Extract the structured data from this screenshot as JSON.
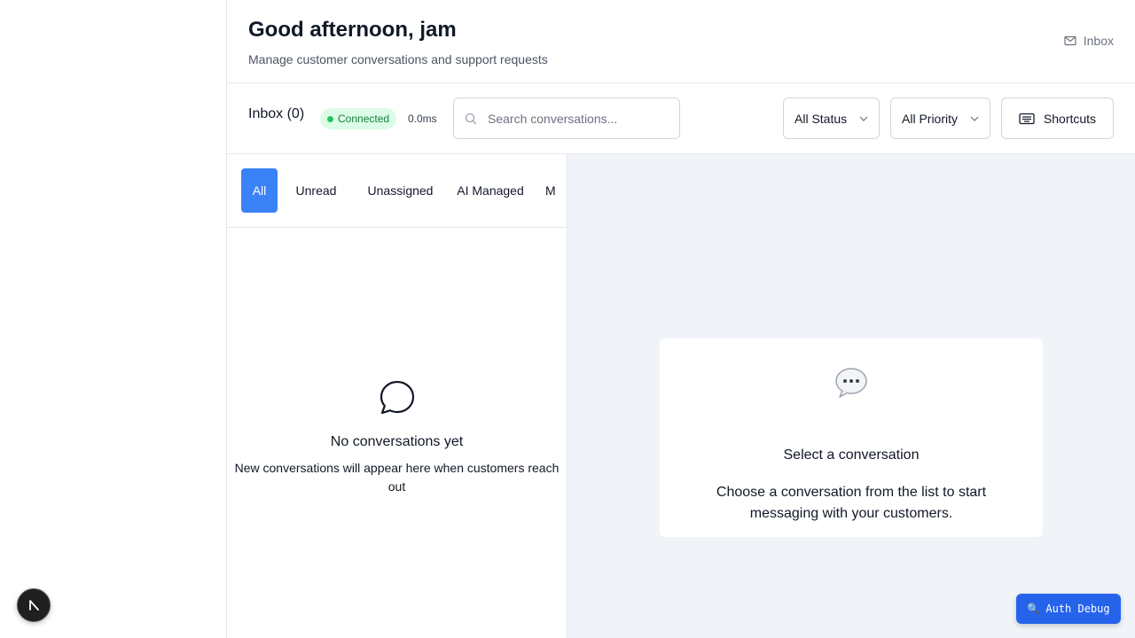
{
  "header": {
    "greeting": "Good afternoon, jam",
    "subtitle": "Manage customer conversations and support requests",
    "inbox_link": "Inbox",
    "inbox_icon": "mail-icon"
  },
  "toolbar": {
    "inbox_label": "Inbox (0)",
    "connection_status": "Connected",
    "latency": "0.0ms",
    "search": {
      "placeholder": "Search conversations...",
      "value": ""
    },
    "status_filter": "All Status",
    "priority_filter": "All Priority",
    "shortcuts_label": "Shortcuts"
  },
  "tabs": [
    {
      "label": "All",
      "active": true
    },
    {
      "label": "Unread",
      "active": false
    },
    {
      "label": "Unassigned",
      "active": false
    },
    {
      "label": "AI Managed",
      "active": false
    },
    {
      "label": "M",
      "active": false
    }
  ],
  "empty_list": {
    "title": "No conversations yet",
    "text": "New conversations will appear here when customers reach out"
  },
  "detail": {
    "title": "Select a conversation",
    "text": "Choose a conversation from the list to start messaging with your customers."
  },
  "auth_debug": {
    "icon": "🔍",
    "label": "Auth Debug"
  },
  "colors": {
    "accent": "#3b82f6",
    "connected_bg": "#dcfce7",
    "connected_text": "#15803d",
    "debug_button": "#2563eb",
    "detail_bg": "#f0f4f9"
  }
}
